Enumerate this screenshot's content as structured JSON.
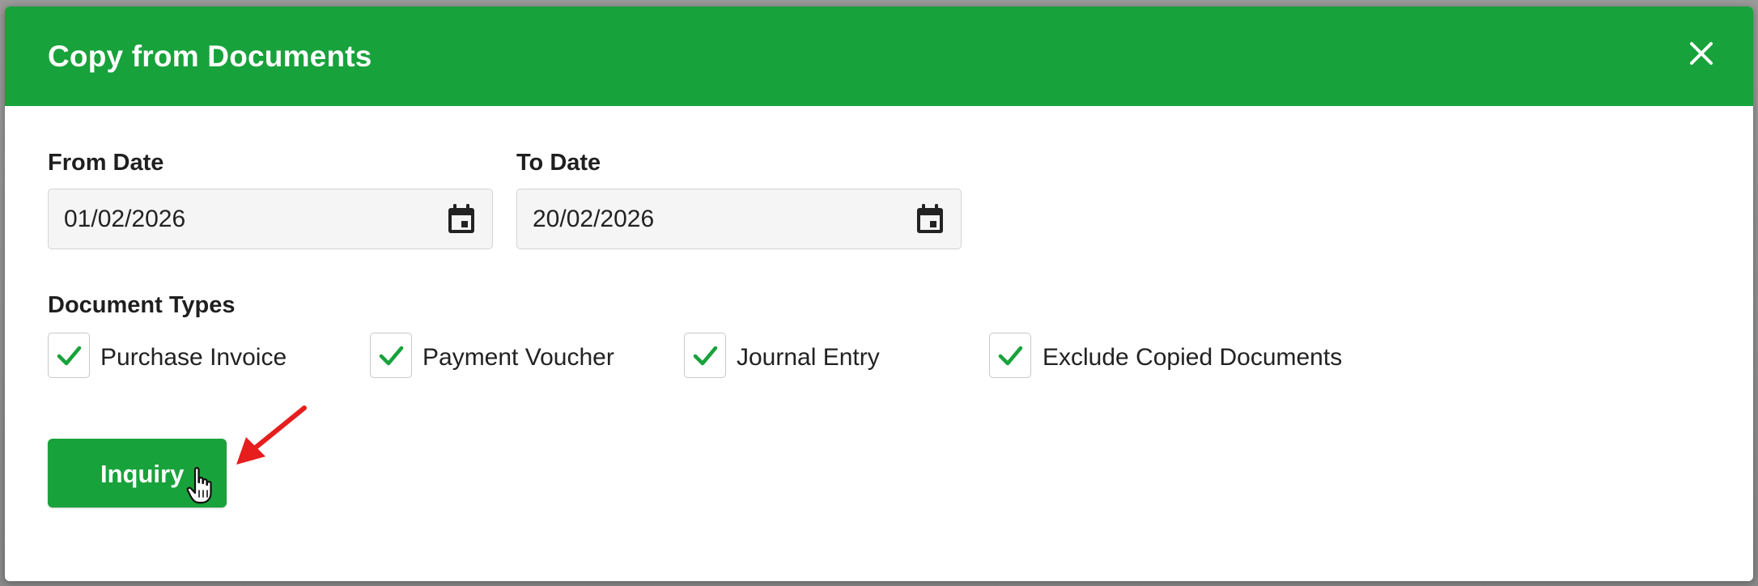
{
  "dialog": {
    "title": "Copy from Documents",
    "close_icon": "close-icon",
    "header_color": "#18a23b"
  },
  "from_date": {
    "label": "From Date",
    "value": "01/02/2026",
    "icon": "calendar-icon"
  },
  "to_date": {
    "label": "To Date",
    "value": "20/02/2026",
    "icon": "calendar-icon"
  },
  "document_types": {
    "label": "Document Types",
    "options": [
      {
        "label": "Purchase Invoice",
        "checked": true
      },
      {
        "label": "Payment Voucher",
        "checked": true
      },
      {
        "label": "Journal Entry",
        "checked": true
      },
      {
        "label": "Exclude Copied Documents",
        "checked": true
      }
    ]
  },
  "actions": {
    "inquiry_label": "Inquiry",
    "accent_color": "#18a23b"
  },
  "annotations": {
    "pointer_icon": "hand-cursor-icon",
    "arrow_icon": "red-arrow-icon",
    "arrow_color": "#e61e1e"
  }
}
